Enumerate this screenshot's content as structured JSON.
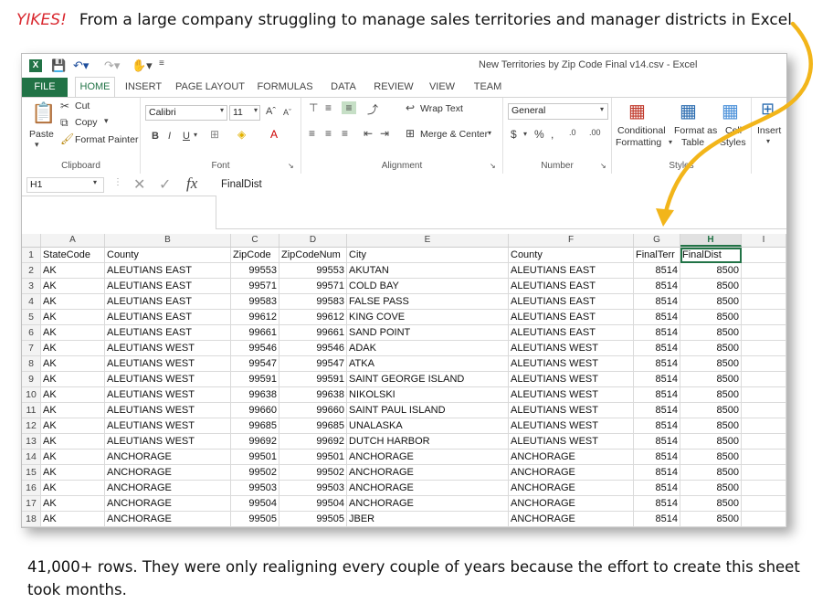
{
  "caption_top": {
    "yikes": "YIKES!",
    "text": "From a large company struggling to manage sales territories and manager districts in Excel"
  },
  "caption_bottom": "41,000+ rows.  They were only realigning every couple of years because the effort to create this sheet took months.",
  "window_title": "New Territories by Zip Code Final v14.csv - Excel",
  "tabs": [
    "FILE",
    "HOME",
    "INSERT",
    "PAGE LAYOUT",
    "FORMULAS",
    "DATA",
    "REVIEW",
    "VIEW",
    "TEAM"
  ],
  "ribbon": {
    "clipboard": {
      "paste": "Paste",
      "cut": "Cut",
      "copy": "Copy",
      "format_painter": "Format Painter",
      "label": "Clipboard"
    },
    "font": {
      "name": "Calibri",
      "size": "11",
      "label": "Font"
    },
    "alignment": {
      "wrap_text": "Wrap Text",
      "merge_center": "Merge & Center",
      "label": "Alignment"
    },
    "number": {
      "format": "General",
      "label": "Number"
    },
    "styles": {
      "conditional": "Conditional",
      "formatting": "Formatting",
      "format_as": "Format as",
      "table": "Table",
      "cell": "Cell",
      "styles": "Styles",
      "label": "Styles"
    },
    "cells": {
      "insert": "Insert"
    }
  },
  "name_box": "H1",
  "formula": "FinalDist",
  "columns": [
    "A",
    "B",
    "C",
    "D",
    "E",
    "F",
    "G",
    "H",
    "I"
  ],
  "rows": [
    [
      "1",
      "StateCode",
      "County",
      "ZipCode",
      "ZipCodeNum",
      "City",
      "County",
      "FinalTerr",
      "FinalDist"
    ],
    [
      "2",
      "AK",
      "ALEUTIANS EAST",
      "99553",
      "99553",
      "AKUTAN",
      "ALEUTIANS EAST",
      "8514",
      "8500"
    ],
    [
      "3",
      "AK",
      "ALEUTIANS EAST",
      "99571",
      "99571",
      "COLD BAY",
      "ALEUTIANS EAST",
      "8514",
      "8500"
    ],
    [
      "4",
      "AK",
      "ALEUTIANS EAST",
      "99583",
      "99583",
      "FALSE PASS",
      "ALEUTIANS EAST",
      "8514",
      "8500"
    ],
    [
      "5",
      "AK",
      "ALEUTIANS EAST",
      "99612",
      "99612",
      "KING COVE",
      "ALEUTIANS EAST",
      "8514",
      "8500"
    ],
    [
      "6",
      "AK",
      "ALEUTIANS EAST",
      "99661",
      "99661",
      "SAND POINT",
      "ALEUTIANS EAST",
      "8514",
      "8500"
    ],
    [
      "7",
      "AK",
      "ALEUTIANS WEST",
      "99546",
      "99546",
      "ADAK",
      "ALEUTIANS WEST",
      "8514",
      "8500"
    ],
    [
      "8",
      "AK",
      "ALEUTIANS WEST",
      "99547",
      "99547",
      "ATKA",
      "ALEUTIANS WEST",
      "8514",
      "8500"
    ],
    [
      "9",
      "AK",
      "ALEUTIANS WEST",
      "99591",
      "99591",
      "SAINT GEORGE ISLAND",
      "ALEUTIANS WEST",
      "8514",
      "8500"
    ],
    [
      "10",
      "AK",
      "ALEUTIANS WEST",
      "99638",
      "99638",
      "NIKOLSKI",
      "ALEUTIANS WEST",
      "8514",
      "8500"
    ],
    [
      "11",
      "AK",
      "ALEUTIANS WEST",
      "99660",
      "99660",
      "SAINT PAUL ISLAND",
      "ALEUTIANS WEST",
      "8514",
      "8500"
    ],
    [
      "12",
      "AK",
      "ALEUTIANS WEST",
      "99685",
      "99685",
      "UNALASKA",
      "ALEUTIANS WEST",
      "8514",
      "8500"
    ],
    [
      "13",
      "AK",
      "ALEUTIANS WEST",
      "99692",
      "99692",
      "DUTCH HARBOR",
      "ALEUTIANS WEST",
      "8514",
      "8500"
    ],
    [
      "14",
      "AK",
      "ANCHORAGE",
      "99501",
      "99501",
      "ANCHORAGE",
      "ANCHORAGE",
      "8514",
      "8500"
    ],
    [
      "15",
      "AK",
      "ANCHORAGE",
      "99502",
      "99502",
      "ANCHORAGE",
      "ANCHORAGE",
      "8514",
      "8500"
    ],
    [
      "16",
      "AK",
      "ANCHORAGE",
      "99503",
      "99503",
      "ANCHORAGE",
      "ANCHORAGE",
      "8514",
      "8500"
    ],
    [
      "17",
      "AK",
      "ANCHORAGE",
      "99504",
      "99504",
      "ANCHORAGE",
      "ANCHORAGE",
      "8514",
      "8500"
    ],
    [
      "18",
      "AK",
      "ANCHORAGE",
      "99505",
      "99505",
      "JBER",
      "ANCHORAGE",
      "8514",
      "8500"
    ]
  ],
  "colors": {
    "excel_green": "#217346",
    "yikes_red": "#d9282f",
    "arrow_gold": "#f2b51a"
  }
}
